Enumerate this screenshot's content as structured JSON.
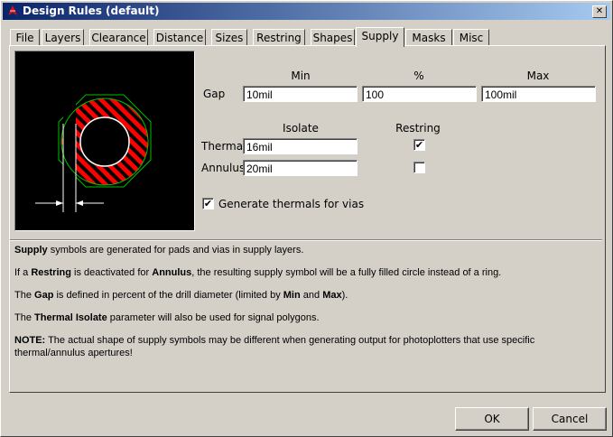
{
  "window": {
    "title": "Design Rules (default)"
  },
  "tabs": [
    "File",
    "Layers",
    "Clearance",
    "Distance",
    "Sizes",
    "Restring",
    "Shapes",
    "Supply",
    "Masks",
    "Misc"
  ],
  "active_tab": "Supply",
  "gap": {
    "row_label": "Gap",
    "min_header": "Min",
    "pct_header": "%",
    "max_header": "Max",
    "min_value": "10mil",
    "pct_value": "100",
    "max_value": "100mil"
  },
  "columns": {
    "isolate_header": "Isolate",
    "restring_header": "Restring"
  },
  "thermal": {
    "label": "Thermal",
    "isolate_value": "16mil",
    "restring_checked": true
  },
  "annulus": {
    "label": "Annulus",
    "isolate_value": "20mil",
    "restring_checked": false
  },
  "generate_thermals": {
    "label": "Generate thermals for vias",
    "checked": true
  },
  "help": {
    "p1_b1": "Supply",
    "p1_t1": " symbols are generated for pads and vias in supply layers.",
    "p2_t1": "If a ",
    "p2_b1": "Restring",
    "p2_t2": " is deactivated for ",
    "p2_b2": "Annulus",
    "p2_t3": ", the resulting supply symbol will be a fully filled circle instead of a ring.",
    "p3_t1": "The ",
    "p3_b1": "Gap",
    "p3_t2": " is defined in percent of the drill diameter (limited by ",
    "p3_b2": "Min",
    "p3_t3": " and ",
    "p3_b3": "Max",
    "p3_t4": ").",
    "p4_t1": "The ",
    "p4_b1": "Thermal Isolate",
    "p4_t2": " parameter will also be used for signal polygons.",
    "p5_b1": "NOTE:",
    "p5_t1": " The actual shape of supply symbols may be different when generating output for photoplotters that use specific thermal/annulus apertures!"
  },
  "buttons": {
    "ok": "OK",
    "cancel": "Cancel"
  },
  "colors": {
    "title_start": "#0a246a",
    "title_end": "#a6caf0",
    "ring": "#ff0000",
    "outline": "#00c000"
  }
}
